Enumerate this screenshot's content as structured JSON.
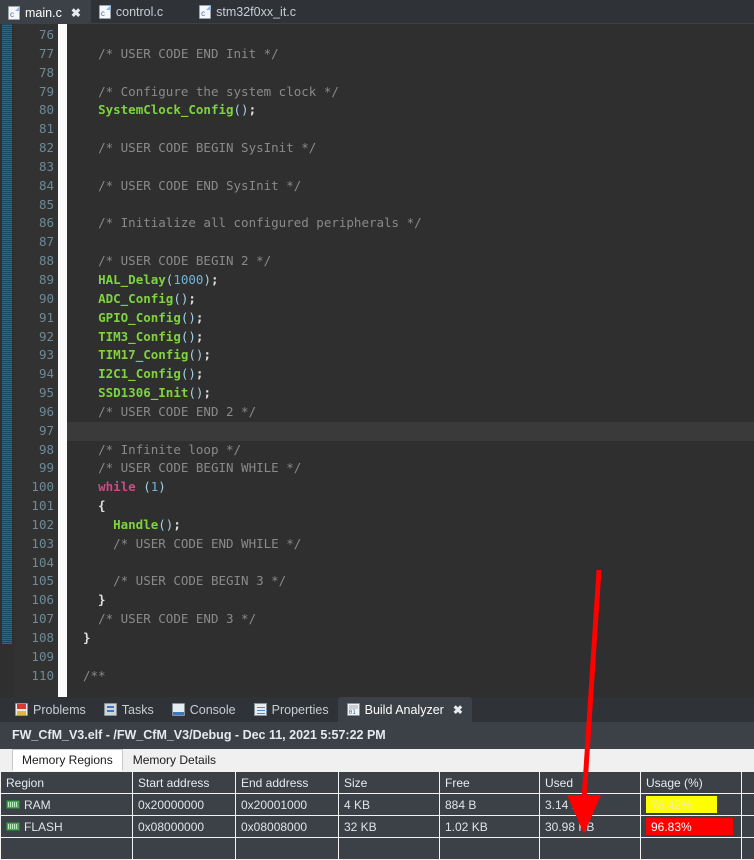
{
  "editor_tabs": [
    {
      "label": "main.c",
      "icon": "c-file-icon",
      "active": true,
      "closable": true
    },
    {
      "label": "control.c",
      "icon": "c-file-icon",
      "active": false,
      "closable": false
    },
    {
      "label": "stm32f0xx_it.c",
      "icon": "c-file-icon",
      "active": false,
      "closable": false
    }
  ],
  "code": {
    "first_line": 76,
    "highlighted_line": 97,
    "lines": [
      {
        "n": 76,
        "tokens": []
      },
      {
        "n": 77,
        "tokens": [
          {
            "t": "  ",
            "c": "plain"
          },
          {
            "t": "/* USER CODE END Init */",
            "c": "cmt"
          }
        ]
      },
      {
        "n": 78,
        "tokens": []
      },
      {
        "n": 79,
        "tokens": [
          {
            "t": "  ",
            "c": "plain"
          },
          {
            "t": "/* Configure the system clock */",
            "c": "cmt"
          }
        ]
      },
      {
        "n": 80,
        "tokens": [
          {
            "t": "  ",
            "c": "plain"
          },
          {
            "t": "SystemClock_Config",
            "c": "fn"
          },
          {
            "t": "()",
            "c": "pun"
          },
          {
            "t": ";",
            "c": "plain"
          }
        ]
      },
      {
        "n": 81,
        "tokens": []
      },
      {
        "n": 82,
        "tokens": [
          {
            "t": "  ",
            "c": "plain"
          },
          {
            "t": "/* USER CODE BEGIN SysInit */",
            "c": "cmt"
          }
        ]
      },
      {
        "n": 83,
        "tokens": []
      },
      {
        "n": 84,
        "tokens": [
          {
            "t": "  ",
            "c": "plain"
          },
          {
            "t": "/* USER CODE END SysInit */",
            "c": "cmt"
          }
        ]
      },
      {
        "n": 85,
        "tokens": []
      },
      {
        "n": 86,
        "tokens": [
          {
            "t": "  ",
            "c": "plain"
          },
          {
            "t": "/* Initialize all configured peripherals */",
            "c": "cmt"
          }
        ]
      },
      {
        "n": 87,
        "tokens": []
      },
      {
        "n": 88,
        "tokens": [
          {
            "t": "  ",
            "c": "plain"
          },
          {
            "t": "/* USER CODE BEGIN 2 */",
            "c": "cmt"
          }
        ]
      },
      {
        "n": 89,
        "tokens": [
          {
            "t": "  ",
            "c": "plain"
          },
          {
            "t": "HAL_Delay",
            "c": "fn"
          },
          {
            "t": "(",
            "c": "pun"
          },
          {
            "t": "1000",
            "c": "num"
          },
          {
            "t": ")",
            "c": "pun"
          },
          {
            "t": ";",
            "c": "plain"
          }
        ]
      },
      {
        "n": 90,
        "tokens": [
          {
            "t": "  ",
            "c": "plain"
          },
          {
            "t": "ADC_Config",
            "c": "fn"
          },
          {
            "t": "()",
            "c": "pun"
          },
          {
            "t": ";",
            "c": "plain"
          }
        ]
      },
      {
        "n": 91,
        "tokens": [
          {
            "t": "  ",
            "c": "plain"
          },
          {
            "t": "GPIO_Config",
            "c": "fn"
          },
          {
            "t": "()",
            "c": "pun"
          },
          {
            "t": ";",
            "c": "plain"
          }
        ]
      },
      {
        "n": 92,
        "tokens": [
          {
            "t": "  ",
            "c": "plain"
          },
          {
            "t": "TIM3_Config",
            "c": "fn"
          },
          {
            "t": "()",
            "c": "pun"
          },
          {
            "t": ";",
            "c": "plain"
          }
        ]
      },
      {
        "n": 93,
        "tokens": [
          {
            "t": "  ",
            "c": "plain"
          },
          {
            "t": "TIM17_Config",
            "c": "fn"
          },
          {
            "t": "()",
            "c": "pun"
          },
          {
            "t": ";",
            "c": "plain"
          }
        ]
      },
      {
        "n": 94,
        "tokens": [
          {
            "t": "  ",
            "c": "plain"
          },
          {
            "t": "I2C1_Config",
            "c": "fn"
          },
          {
            "t": "()",
            "c": "pun"
          },
          {
            "t": ";",
            "c": "plain"
          }
        ]
      },
      {
        "n": 95,
        "tokens": [
          {
            "t": "  ",
            "c": "plain"
          },
          {
            "t": "SSD1306_Init",
            "c": "fn"
          },
          {
            "t": "()",
            "c": "pun"
          },
          {
            "t": ";",
            "c": "plain"
          }
        ]
      },
      {
        "n": 96,
        "tokens": [
          {
            "t": "  ",
            "c": "plain"
          },
          {
            "t": "/* USER CODE END 2 */",
            "c": "cmt"
          }
        ]
      },
      {
        "n": 97,
        "tokens": []
      },
      {
        "n": 98,
        "tokens": [
          {
            "t": "  ",
            "c": "plain"
          },
          {
            "t": "/* Infinite loop */",
            "c": "cmt"
          }
        ]
      },
      {
        "n": 99,
        "tokens": [
          {
            "t": "  ",
            "c": "plain"
          },
          {
            "t": "/* USER CODE BEGIN WHILE */",
            "c": "cmt"
          }
        ]
      },
      {
        "n": 100,
        "tokens": [
          {
            "t": "  ",
            "c": "plain"
          },
          {
            "t": "while",
            "c": "kw"
          },
          {
            "t": " ",
            "c": "plain"
          },
          {
            "t": "(",
            "c": "pun"
          },
          {
            "t": "1",
            "c": "num"
          },
          {
            "t": ")",
            "c": "pun"
          }
        ]
      },
      {
        "n": 101,
        "tokens": [
          {
            "t": "  {",
            "c": "plain"
          }
        ]
      },
      {
        "n": 102,
        "tokens": [
          {
            "t": "    ",
            "c": "plain"
          },
          {
            "t": "Handle",
            "c": "fn"
          },
          {
            "t": "()",
            "c": "pun"
          },
          {
            "t": ";",
            "c": "plain"
          }
        ]
      },
      {
        "n": 103,
        "tokens": [
          {
            "t": "    ",
            "c": "plain"
          },
          {
            "t": "/* USER CODE END WHILE */",
            "c": "cmt"
          }
        ]
      },
      {
        "n": 104,
        "tokens": []
      },
      {
        "n": 105,
        "tokens": [
          {
            "t": "    ",
            "c": "plain"
          },
          {
            "t": "/* USER CODE BEGIN 3 */",
            "c": "cmt"
          }
        ]
      },
      {
        "n": 106,
        "tokens": [
          {
            "t": "  }",
            "c": "plain"
          }
        ]
      },
      {
        "n": 107,
        "tokens": [
          {
            "t": "  ",
            "c": "plain"
          },
          {
            "t": "/* USER CODE END 3 */",
            "c": "cmt"
          }
        ]
      },
      {
        "n": 108,
        "tokens": [
          {
            "t": "}",
            "c": "plain"
          }
        ]
      },
      {
        "n": 109,
        "tokens": []
      },
      {
        "n": 110,
        "tokens": [
          {
            "t": "/**",
            "c": "cmt"
          }
        ],
        "fold": true
      }
    ]
  },
  "panel": {
    "tabs": [
      {
        "label": "Problems",
        "icon": "problems-icon",
        "active": false
      },
      {
        "label": "Tasks",
        "icon": "tasks-icon",
        "active": false
      },
      {
        "label": "Console",
        "icon": "console-icon",
        "active": false
      },
      {
        "label": "Properties",
        "icon": "properties-icon",
        "active": false
      },
      {
        "label": "Build Analyzer",
        "icon": "build-analyzer-icon",
        "active": true,
        "closable": true
      }
    ],
    "close_glyph": "✖",
    "title": "FW_CfM_V3.elf - /FW_CfM_V3/Debug - Dec 11, 2021 5:57:22 PM",
    "sub_tabs": [
      {
        "label": "Memory Regions",
        "active": true
      },
      {
        "label": "Memory Details",
        "active": false
      }
    ],
    "table": {
      "columns": [
        "Region",
        "Start address",
        "End address",
        "Size",
        "Free",
        "Used",
        "Usage (%)",
        ""
      ],
      "rows": [
        {
          "region": "RAM",
          "icon": "memory-chip-icon",
          "start_address": "0x20000000",
          "end_address": "0x20001000",
          "size": "4 KB",
          "free": "884 B",
          "used": "3.14 KB",
          "usage_label": "78.42%",
          "usage_percent": 78.42,
          "usage_color": "#ffff00",
          "usage_level": "warn"
        },
        {
          "region": "FLASH",
          "icon": "memory-chip-icon",
          "start_address": "0x08000000",
          "end_address": "0x08008000",
          "size": "32 KB",
          "free": "1.02 KB",
          "used": "30.98 KB",
          "usage_label": "96.83%",
          "usage_percent": 96.83,
          "usage_color": "#ff0000",
          "usage_level": "crit"
        },
        {
          "region": "",
          "icon": "",
          "start_address": "",
          "end_address": "",
          "size": "",
          "free": "",
          "used": "",
          "usage_label": "",
          "usage_percent": 0,
          "usage_color": "",
          "usage_level": ""
        }
      ]
    }
  },
  "annotation": {
    "arrow_color": "#ff0000",
    "points_to": "used-and-usage-columns"
  }
}
